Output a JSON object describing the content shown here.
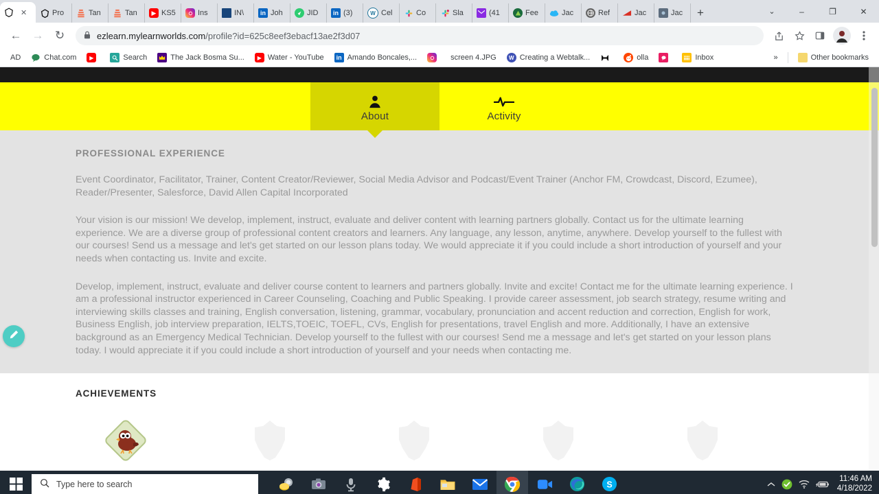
{
  "browser": {
    "tabs": [
      {
        "label": "",
        "icon": "brave-icon",
        "active": true,
        "color": "#ffffff"
      },
      {
        "label": "Pro",
        "icon": "brave-icon",
        "active": false,
        "color": "#ffffff"
      },
      {
        "label": "Tan",
        "icon": "doc-icon",
        "active": false,
        "color": "#f4714e"
      },
      {
        "label": "Tan",
        "icon": "doc-icon",
        "active": false,
        "color": "#f4714e"
      },
      {
        "label": "KS5",
        "icon": "youtube-icon",
        "active": false,
        "color": "#ff0000"
      },
      {
        "label": "Ins",
        "icon": "instagram-icon",
        "active": false,
        "color": "#e1306c"
      },
      {
        "label": "IN\\",
        "icon": "linkedin-square-icon",
        "active": false,
        "color": "#18457a"
      },
      {
        "label": "Joh",
        "icon": "linkedin-icon",
        "active": false,
        "color": "#0a66c2"
      },
      {
        "label": "JID",
        "icon": "green-circle-icon",
        "active": false,
        "color": "#2ecc71"
      },
      {
        "label": "(3)",
        "icon": "linkedin-icon",
        "active": false,
        "color": "#0a66c2"
      },
      {
        "label": "Cel",
        "icon": "wordpress-icon",
        "active": false,
        "color": "#21759b"
      },
      {
        "label": "Co",
        "icon": "slack-icon",
        "active": false,
        "color": "#4a154b"
      },
      {
        "label": "Sla",
        "icon": "slack-icon",
        "active": false,
        "color": "#4a154b"
      },
      {
        "label": "(41",
        "icon": "mail-icon",
        "active": false,
        "color": "#8a2be2"
      },
      {
        "label": "Fee",
        "icon": "feedly-icon",
        "active": false,
        "color": "#2bb24c"
      },
      {
        "label": "Jac",
        "icon": "cloud-icon",
        "active": false,
        "color": "#29b6f6"
      },
      {
        "label": "Ref",
        "icon": "globe-icon",
        "active": false,
        "color": "#555555"
      },
      {
        "label": "Jac",
        "icon": "red-flag-icon",
        "active": false,
        "color": "#d93025"
      },
      {
        "label": "Jac",
        "icon": "photo-icon",
        "active": false,
        "color": "#6b7a8f"
      }
    ],
    "new_tab_label": "+",
    "close_tab_label": "✕",
    "window_controls": {
      "chevron": "⌄",
      "minimize": "–",
      "maximize": "❐",
      "close": "✕"
    },
    "nav": {
      "back": "←",
      "forward": "→",
      "reload": "↻"
    },
    "omnibox": {
      "lock_icon": "lock-icon",
      "url_domain": "ezlearn.mylearnworlds.com",
      "url_path": "/profile?id=625c8eef3ebacf13ae2f3d07"
    },
    "toolbar_icons": [
      "share-icon",
      "bookmark-star-icon",
      "side-panel-icon",
      "profile-avatar-icon",
      "three-dot-menu-icon"
    ],
    "bookmarks": [
      {
        "label": "AD",
        "icon": "text-icon",
        "color": "transparent"
      },
      {
        "label": "Chat.com",
        "icon": "green-chat-icon",
        "color": "#2e8b57"
      },
      {
        "label": "",
        "icon": "youtube-icon",
        "color": "#ff0000"
      },
      {
        "label": "Search",
        "icon": "teal-search-icon",
        "color": "#26a69a"
      },
      {
        "label": "The Jack Bosma Su...",
        "icon": "purple-crown-icon",
        "color": "#4b0082"
      },
      {
        "label": "Water - YouTube",
        "icon": "youtube-icon",
        "color": "#ff0000"
      },
      {
        "label": "Amando Boncales,...",
        "icon": "linkedin-icon",
        "color": "#0a66c2"
      },
      {
        "label": "",
        "icon": "instagram-icon",
        "color": "#e1306c"
      },
      {
        "label": "screen 4.JPG",
        "icon": "file-icon",
        "color": "transparent"
      },
      {
        "label": "Creating a Webtalk...",
        "icon": "webtalk-icon",
        "color": "#3f51b5"
      },
      {
        "label": "",
        "icon": "black-bow-icon",
        "color": "#111111"
      },
      {
        "label": "olla",
        "icon": "reddit-icon",
        "color": "#ff4500"
      },
      {
        "label": "",
        "icon": "message-icon",
        "color": "#e91e63"
      },
      {
        "label": "Inbox",
        "icon": "inbox-icon",
        "color": "#ffc107"
      }
    ],
    "bookmarks_overflow": "»",
    "other_bookmarks": {
      "label": "Other bookmarks",
      "icon": "folder-icon"
    }
  },
  "page": {
    "nav_tabs": [
      {
        "label": "About",
        "icon": "person-icon",
        "active": true
      },
      {
        "label": "Activity",
        "icon": "activity-pulse-icon",
        "active": false
      }
    ],
    "about": {
      "section_title": "PROFESSIONAL EXPERIENCE",
      "paragraphs": [
        "Event Coordinator, Facilitator, Trainer, Content Creator/Reviewer, Social Media Advisor and Podcast/Event Trainer (Anchor FM, Crowdcast, Discord, Ezumee), Reader/Presenter, Salesforce, David Allen Capital Incorporated",
        "Your vision is our mission! We develop, implement, instruct, evaluate and deliver content with learning partners globally. Contact us for the ultimate learning experience. We are a diverse group of professional content creators and learners. Any language, any lesson, anytime, anywhere. Develop yourself to the fullest with our courses! Send us a message and let's get started on our lesson plans today. We would appreciate it if you could include a short introduction of yourself and your needs when contacting us. Invite and excite.",
        "Develop, implement, instruct, evaluate and deliver course content to learners and partners globally. Invite and excite! Contact me for the ultimate learning experience. I am a professional instructor experienced in Career Counseling, Coaching and Public Speaking. I provide career assessment, job search strategy, resume writing and interviewing skills classes and training, English conversation, listening, grammar, vocabulary, pronunciation and accent reduction and correction, English for work, Business English, job interview preparation, IELTS,TOEIC, TOEFL, CVs, English for presentations, travel English and more. Additionally, I have an extensive background as an Emergency Medical Technician. Develop yourself to the fullest with our courses! Send me a message and let's get started on your lesson plans today. I would appreciate it if you could include a short introduction of yourself and your needs when contacting me."
      ]
    },
    "achievements": {
      "section_title": "ACHIEVEMENTS",
      "badges": [
        {
          "name": "early-bird-badge",
          "earned": true
        },
        {
          "name": "locked-badge-1",
          "earned": false
        },
        {
          "name": "locked-badge-2",
          "earned": false
        },
        {
          "name": "locked-badge-3",
          "earned": false
        },
        {
          "name": "locked-badge-4",
          "earned": false
        }
      ]
    },
    "edit_button": {
      "icon": "pencil-icon",
      "color": "#4ecdc4"
    }
  },
  "taskbar": {
    "start_icon": "windows-start-icon",
    "search_placeholder": "Type here to search",
    "search_icon": "magnifier-icon",
    "apps": [
      {
        "name": "money-disk-icon",
        "active": false
      },
      {
        "name": "camera-icon",
        "active": false
      },
      {
        "name": "microphone-icon",
        "active": false
      },
      {
        "name": "settings-gear-icon",
        "active": false
      },
      {
        "name": "office-icon",
        "active": false
      },
      {
        "name": "file-explorer-icon",
        "active": true
      },
      {
        "name": "mail-icon",
        "active": true
      },
      {
        "name": "chrome-icon",
        "active": true
      },
      {
        "name": "zoom-icon",
        "active": true
      },
      {
        "name": "edge-icon",
        "active": true
      },
      {
        "name": "skype-icon",
        "active": true
      }
    ],
    "tray": [
      "chevron-up-icon",
      "antivirus-shield-icon",
      "wifi-icon",
      "battery-icon"
    ],
    "time": "11:46 AM",
    "date": "4/18/2022"
  }
}
